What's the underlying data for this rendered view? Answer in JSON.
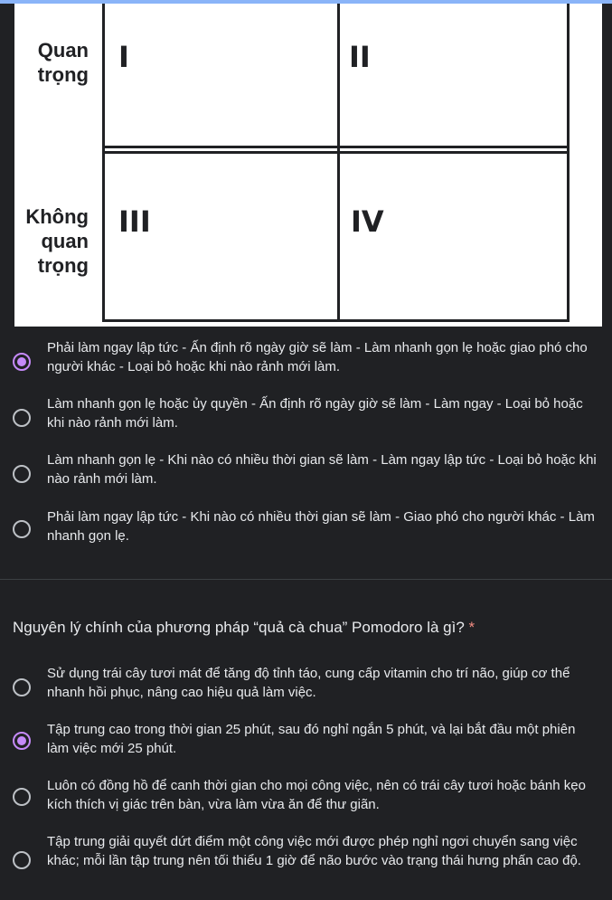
{
  "figure": {
    "row_labels": [
      "Quan\ntrọng",
      "Không\nquan\ntrọng"
    ],
    "cells": [
      "I",
      "II",
      "III",
      "IV"
    ]
  },
  "q1_options": [
    {
      "text": "Phải làm ngay lập tức - Ấn định rõ ngày giờ sẽ làm - Làm nhanh gọn lẹ hoặc giao phó cho người khác - Loại bỏ hoặc khi nào rảnh mới làm.",
      "selected": true
    },
    {
      "text": "Làm nhanh gọn lẹ hoặc ủy quyền - Ấn định rõ ngày giờ sẽ làm - Làm ngay - Loại bỏ hoặc khi nào rảnh mới làm.",
      "selected": false
    },
    {
      "text": "Làm nhanh gọn lẹ - Khi nào có nhiều thời gian sẽ làm - Làm ngay lập tức - Loại bỏ hoặc khi nào rảnh mới làm.",
      "selected": false
    },
    {
      "text": "Phải làm ngay lập tức - Khi nào có nhiều thời gian sẽ làm - Giao phó cho người khác - Làm nhanh gọn lẹ.",
      "selected": false
    }
  ],
  "q2": {
    "title": "Nguyên lý chính của phương pháp “quả cà chua” Pomodoro là gì?",
    "required_mark": "*",
    "options": [
      {
        "text": "Sử dụng trái cây tươi mát để tăng độ tỉnh táo, cung cấp vitamin cho trí não, giúp cơ thể nhanh hồi phục, nâng cao hiệu quả làm việc.",
        "selected": false
      },
      {
        "text": "Tập trung cao trong thời gian 25 phút, sau đó nghỉ ngắn 5 phút, và lại bắt đầu một phiên làm việc mới 25 phút.",
        "selected": true
      },
      {
        "text": "Luôn có đồng hồ để canh thời gian cho mọi công việc, nên có trái cây tươi hoặc bánh kẹo kích thích vị giác trên bàn, vừa làm vừa ăn để thư giãn.",
        "selected": false
      },
      {
        "text": "Tập trung giải quyết dứt điểm một công việc mới được phép nghỉ ngơi chuyển sang việc khác; mỗi lần tập trung nên tối thiểu 1 giờ để não bước vào trạng thái hưng phấn cao độ.",
        "selected": false
      }
    ]
  }
}
